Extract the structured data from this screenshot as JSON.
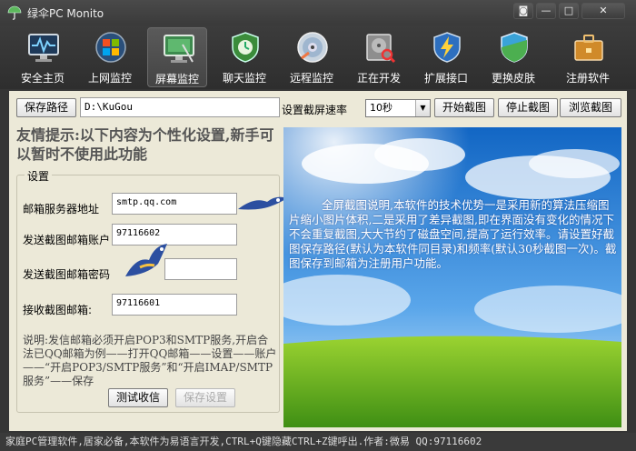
{
  "window": {
    "title": "绿伞PC Monito",
    "buttons": {
      "skin": "◙",
      "minimize": "—",
      "maximize": "□",
      "close": "✕"
    }
  },
  "toolbar": {
    "items": [
      {
        "label": "安全主页",
        "icon": "monitor-pulse-icon"
      },
      {
        "label": "上网监控",
        "icon": "windows-logo-icon"
      },
      {
        "label": "屏幕监控",
        "icon": "screen-monitor-icon",
        "active": true
      },
      {
        "label": "聊天监控",
        "icon": "shield-clock-icon"
      },
      {
        "label": "远程监控",
        "icon": "disc-icon"
      },
      {
        "label": "正在开发",
        "icon": "hard-drive-search-icon"
      },
      {
        "label": "扩展接口",
        "icon": "shield-lightning-icon"
      },
      {
        "label": "更换皮肤",
        "icon": "shield-skin-icon"
      },
      {
        "label": "注册软件",
        "icon": "briefcase-icon"
      }
    ]
  },
  "controls": {
    "save_path_label": "保存路径",
    "save_path_value": "D:\\KuGou",
    "rate_label": "设置截屏速率",
    "rate_value": "10秒",
    "start_button": "开始截图",
    "stop_button": "停止截图",
    "browse_button": "浏览截图"
  },
  "tip": {
    "text": "友情提示:以下内容为个性化设置,新手可以暂时不使用此功能"
  },
  "settings": {
    "group_title": "设置",
    "mail_server_label": "邮箱服务器地址",
    "mail_server_value": "smtp.qq.com",
    "sender_account_label": "发送截图邮箱账户",
    "sender_account_value": "97116602",
    "sender_password_label": "发送截图邮箱密码",
    "sender_password_value": "",
    "receiver_label": "接收截图邮箱:",
    "receiver_value": "97116601",
    "description": "说明:发信邮箱必须开启POP3和SMTP服务,开启合法已QQ邮箱为例——打开QQ邮箱——设置——账户——“开启POP3/SMTP服务”和“开启IMAP/SMTP服务”——保存",
    "test_button": "测试收信",
    "save_button": "保存设置"
  },
  "preview": {
    "text": "全屏截图说明,本软件的技术优势一是采用新的算法压缩图片缩小图片体积,二是采用了差异截图,即在界面没有变化的情况下不会重复截图,大大节约了磁盘空间,提高了运行效率。请设置好截图保存路径(默认为本软件同目录)和频率(默认30秒截图一次)。截图保存到邮箱为注册用户功能。"
  },
  "statusbar": {
    "text": "家庭PC管理软件,居家必备,本软件为易语言开发,CTRL+Q键隐藏CTRL+Z键呼出.作者:微易 QQ:97116602"
  }
}
